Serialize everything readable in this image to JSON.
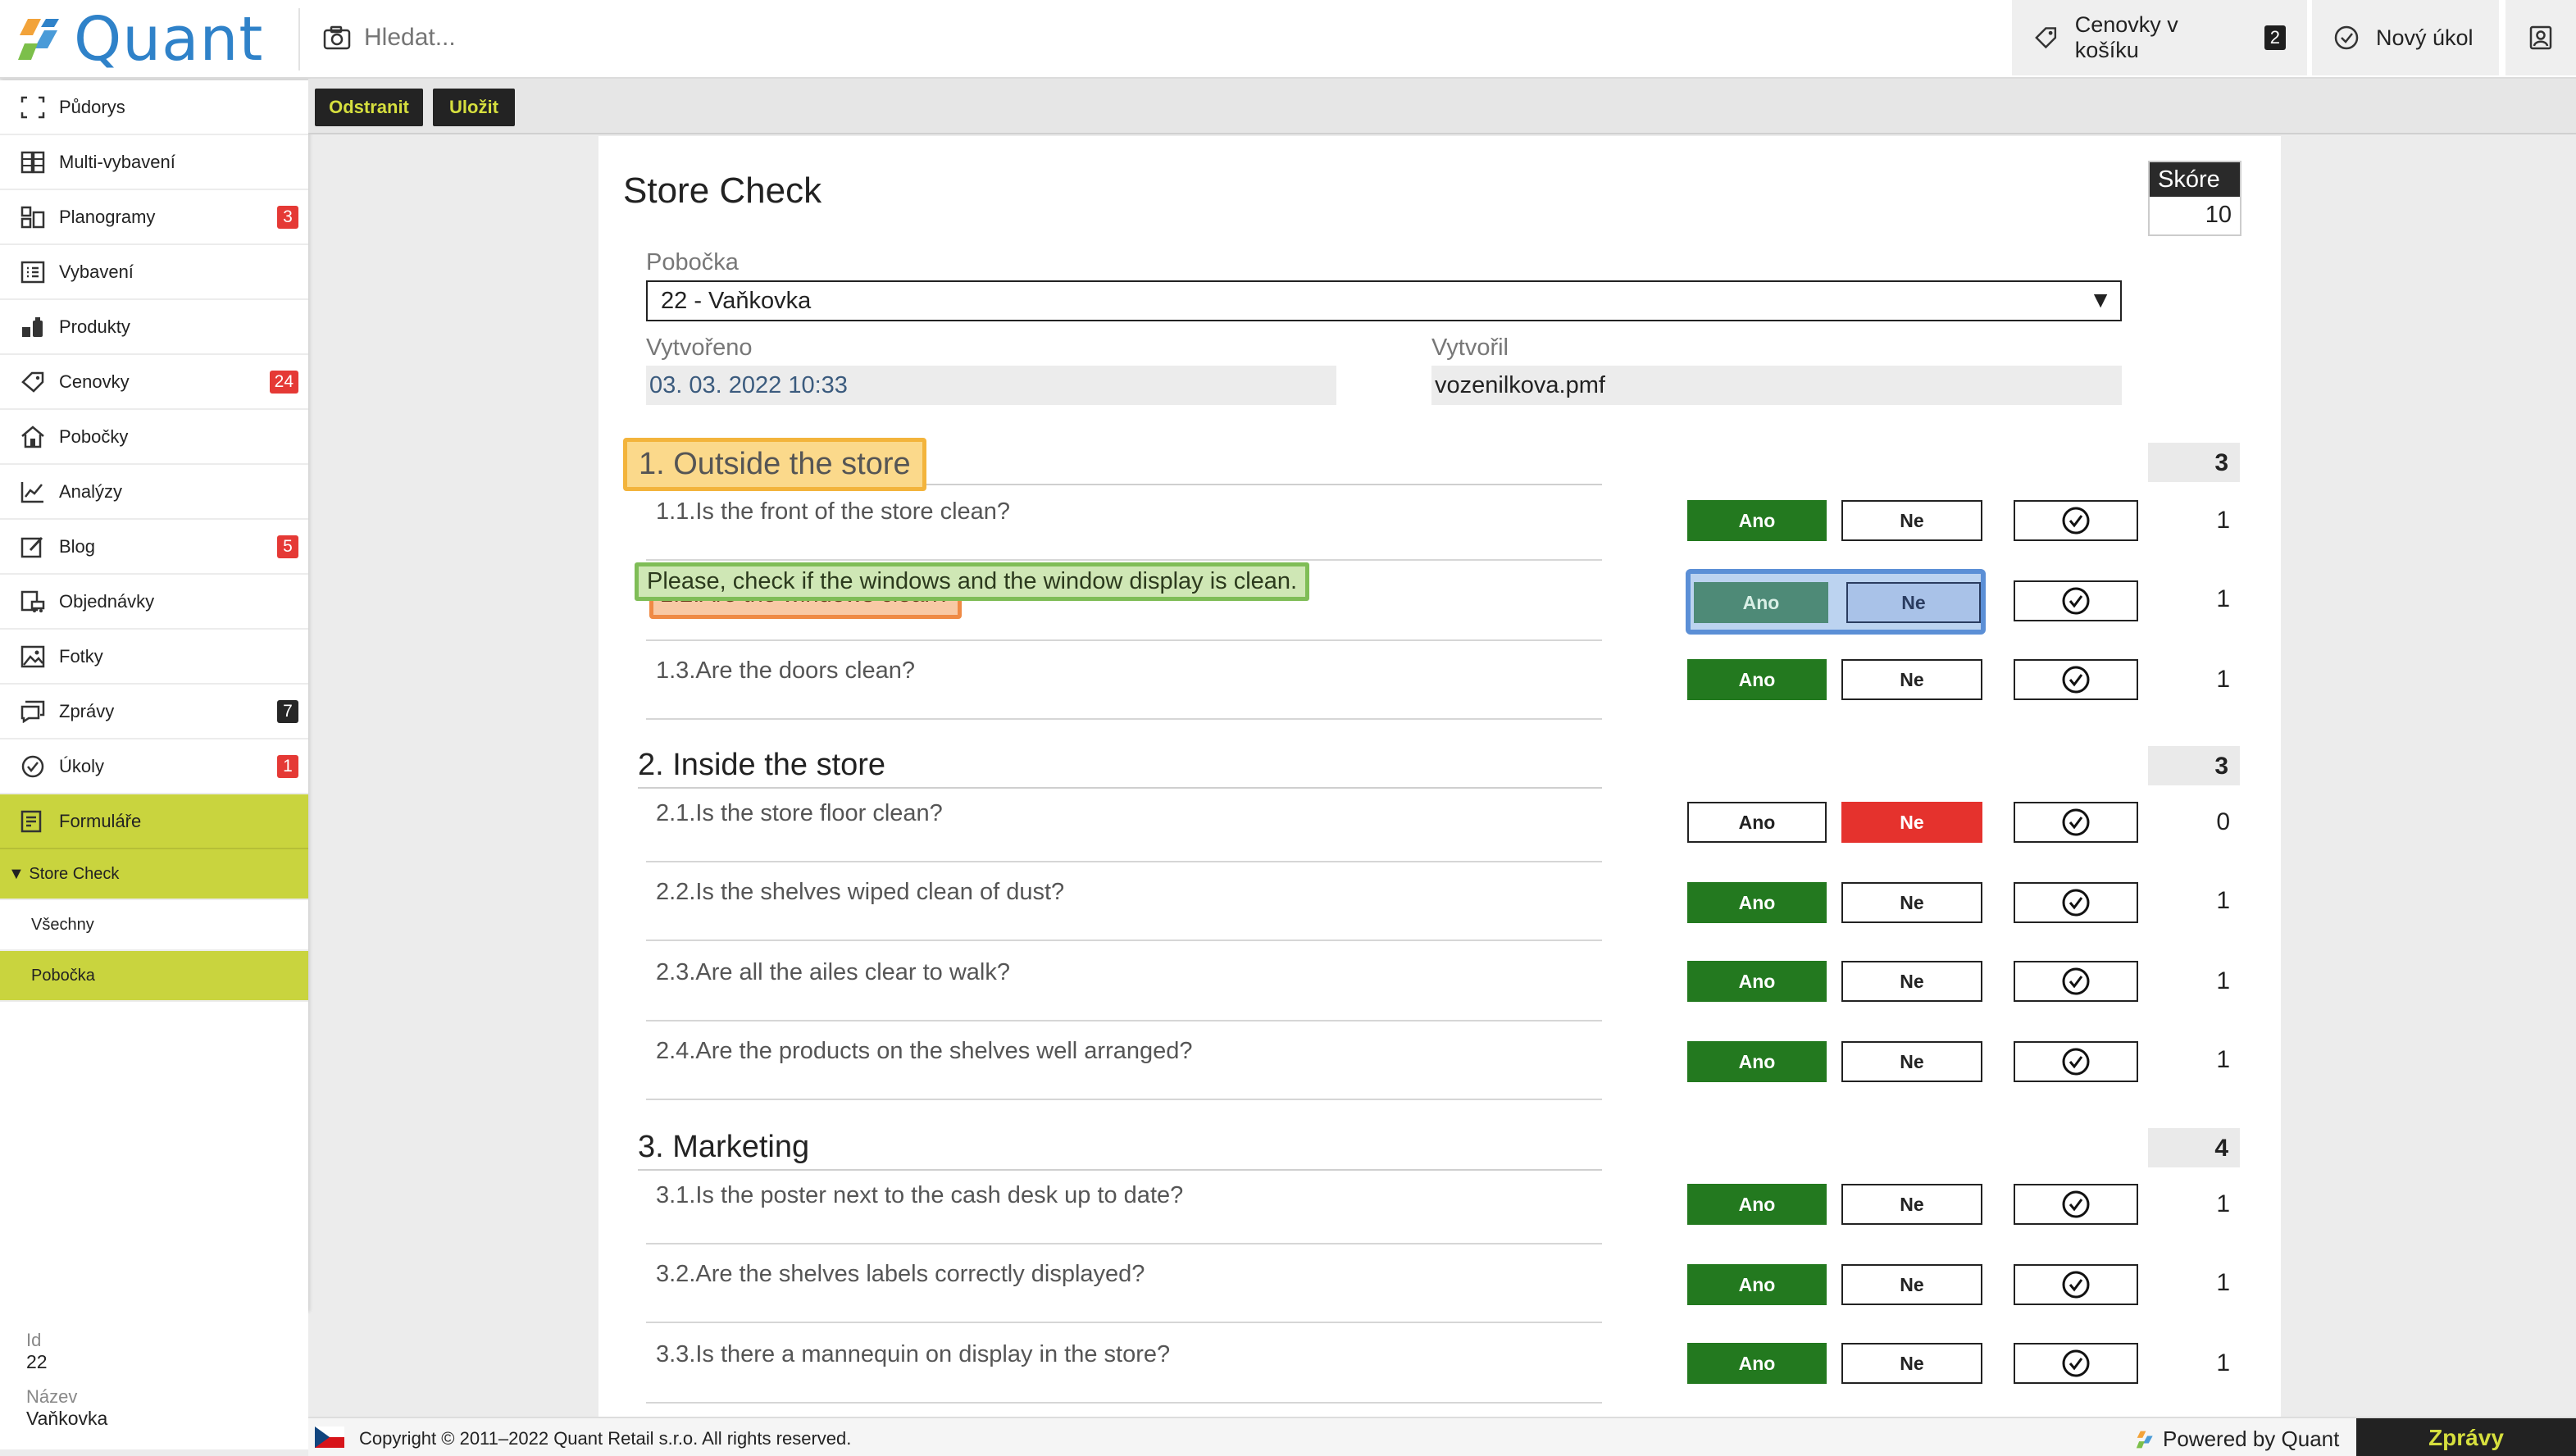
{
  "app": {
    "name": "Quant",
    "brand_color": "#2f82c9",
    "accent": "#c9d43e"
  },
  "search": {
    "placeholder": "Hledat..."
  },
  "topbar": {
    "cart_label": "Cenovky v košíku",
    "cart_count": "2",
    "new_task_label": "Nový úkol"
  },
  "sidebar": {
    "items": [
      {
        "label": "Půdorys",
        "icon": "floorplan-icon"
      },
      {
        "label": "Multi-vybavení",
        "icon": "multi-equipment-icon"
      },
      {
        "label": "Planogramy",
        "icon": "planogram-icon",
        "badge": "3"
      },
      {
        "label": "Vybavení",
        "icon": "equipment-icon"
      },
      {
        "label": "Produkty",
        "icon": "products-icon"
      },
      {
        "label": "Cenovky",
        "icon": "price-tag-icon",
        "badge": "24"
      },
      {
        "label": "Pobočky",
        "icon": "store-icon"
      },
      {
        "label": "Analýzy",
        "icon": "analytics-icon"
      },
      {
        "label": "Blog",
        "icon": "blog-icon",
        "badge": "5"
      },
      {
        "label": "Objednávky",
        "icon": "orders-icon"
      },
      {
        "label": "Fotky",
        "icon": "photos-icon"
      },
      {
        "label": "Zprávy",
        "icon": "messages-icon",
        "badge": "7"
      },
      {
        "label": "Úkoly",
        "icon": "tasks-icon",
        "badge": "1"
      },
      {
        "label": "Formuláře",
        "icon": "forms-icon"
      }
    ],
    "sub_parent": "▼ Store Check",
    "sub_items": [
      "Všechny",
      "Pobočka"
    ],
    "info": {
      "id_label": "Id",
      "id_value": "22",
      "name_label": "Název",
      "name_value": "Vaňkovka"
    }
  },
  "actions": {
    "delete_label": "Odstranit",
    "save_label": "Uložit"
  },
  "form": {
    "title": "Store Check",
    "score_label": "Skóre",
    "score_value": "10",
    "branch_label": "Pobočka",
    "branch_value": "22 - Vaňkovka",
    "created_label": "Vytvořeno",
    "created_value": "03. 03. 2022 10:33",
    "author_label": "Vytvořil",
    "author_value": "vozenilkova.pmf",
    "yes_label": "Ano",
    "no_label": "Ne",
    "sections": [
      {
        "title": "1. Outside the store",
        "score": "3"
      },
      {
        "title": "2. Inside the store",
        "score": "3"
      },
      {
        "title": "3. Marketing",
        "score": "4"
      }
    ],
    "questions": [
      {
        "text": "1.1.Is the front of the store clean?",
        "answer": "yes",
        "points": "1"
      },
      {
        "text": "1.2.Are the windows clean?",
        "answer": "focus",
        "points": "1",
        "note": "Please, check if the windows and the window display is clean."
      },
      {
        "text": "1.3.Are the doors clean?",
        "answer": "yes",
        "points": "1"
      },
      {
        "text": "2.1.Is the store floor clean?",
        "answer": "no",
        "points": "0"
      },
      {
        "text": "2.2.Is the shelves wiped clean of dust?",
        "answer": "yes",
        "points": "1"
      },
      {
        "text": "2.3.Are all the ailes clear to walk?",
        "answer": "yes",
        "points": "1"
      },
      {
        "text": "2.4.Are the products on the shelves well arranged?",
        "answer": "yes",
        "points": "1"
      },
      {
        "text": "3.1.Is the poster next to the cash desk up to date?",
        "answer": "yes",
        "points": "1"
      },
      {
        "text": "3.2.Are the shelves labels correctly displayed?",
        "answer": "yes",
        "points": "1"
      },
      {
        "text": "3.3.Is there a mannequin on display in the store?",
        "answer": "yes",
        "points": "1"
      }
    ]
  },
  "footer": {
    "copyright": "Copyright © 2011–2022 Quant Retail s.r.o. All rights reserved.",
    "powered": "Powered by Quant",
    "messages_label": "Zprávy"
  }
}
